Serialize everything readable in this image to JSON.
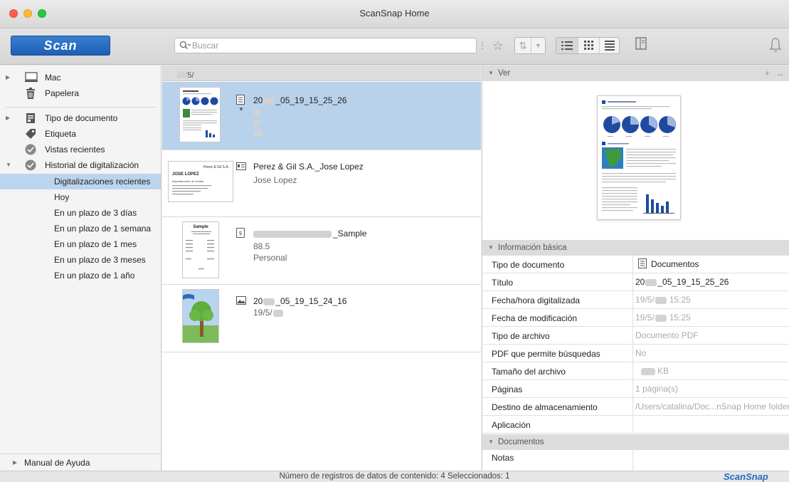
{
  "window": {
    "title": "ScanSnap Home"
  },
  "toolbar": {
    "scan_label": "Scan",
    "search_placeholder": "Buscar",
    "star_icon": "star-icon",
    "notify_icon": "bell-icon"
  },
  "sidebar": {
    "items": [
      {
        "label": "Mac"
      },
      {
        "label": "Papelera"
      },
      {
        "label": "Tipo de documento"
      },
      {
        "label": "Etiqueta"
      },
      {
        "label": "Vistas recientes"
      },
      {
        "label": "Historial de digitalización"
      },
      {
        "label": "Digitalizaciones recientes"
      },
      {
        "label": "Hoy"
      },
      {
        "label": "En un plazo de 3 días"
      },
      {
        "label": "En un plazo de 1 semana"
      },
      {
        "label": "En un plazo de 1 mes"
      },
      {
        "label": "En un plazo de 3 meses"
      },
      {
        "label": "En un plazo de 1 año"
      }
    ],
    "help_label": "Manual de Ayuda"
  },
  "list": {
    "group_date": "19/5/",
    "cards": [
      {
        "name_prefix": "20",
        "name_suffix": "_05_19_15_25_26"
      },
      {
        "name": "Perez & Gil S.A._Jose Lopez",
        "sub1": "Jose Lopez",
        "thumb_company": "Perez & Gil S.A.",
        "thumb_person": "JOSE LOPEZ",
        "thumb_dept": "Departamento de Ventas"
      },
      {
        "name_suffix": "_Sample",
        "sub1": "88.5",
        "sub2": "Personal",
        "thumb_title": "Sample"
      },
      {
        "name_prefix": "20",
        "name_suffix": "_05_19_15_24_16",
        "sub1": "19/5/"
      }
    ]
  },
  "right": {
    "view_label": "Ver",
    "basic_label": "Información básica",
    "docs_label": "Documentos",
    "props": [
      {
        "k": "Tipo de documento",
        "v": "Documentos"
      },
      {
        "k": "Título",
        "v_prefix": "20",
        "v_suffix": "_05_19_15_25_26"
      },
      {
        "k": "Fecha/hora digitalizada",
        "v_prefix": "19/5/",
        "v_suffix": "15:25"
      },
      {
        "k": "Fecha de modificación",
        "v_prefix": "19/5/",
        "v_suffix": "15:25"
      },
      {
        "k": "Tipo de archivo",
        "v": "Documento PDF"
      },
      {
        "k": "PDF que permite búsquedas",
        "v": "No"
      },
      {
        "k": "Tamaño del archivo",
        "v_suffix": "KB"
      },
      {
        "k": "Páginas",
        "v": "1 página(s)"
      },
      {
        "k": "Destino de almacenamiento",
        "v": "/Users/catalina/Doc...nSnap Home folder"
      },
      {
        "k": "Aplicación",
        "v": ""
      }
    ],
    "notes_label": "Notas"
  },
  "status": {
    "text": "Número de registros de datos de contenido: 4  Seleccionados: 1",
    "brand": "ScanSnap"
  },
  "colors": {
    "accent": "#1c5eb5",
    "selection": "#b9d2ec"
  }
}
